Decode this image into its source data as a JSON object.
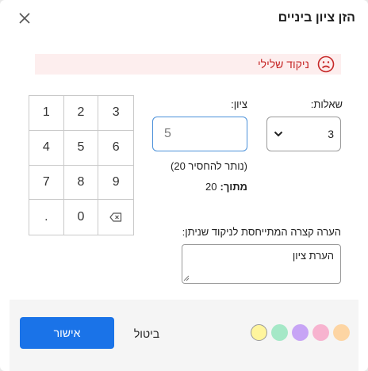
{
  "dialog": {
    "title": "הזן ציון ביניים",
    "alert_text": "ניקוד שלילי"
  },
  "keypad": {
    "keys": [
      "1",
      "2",
      "3",
      "4",
      "5",
      "6",
      "7",
      "8",
      "9",
      ".",
      "0",
      "backspace"
    ]
  },
  "form": {
    "questions_label": "שאלות:",
    "questions_value": "3",
    "grade_label": "ציון:",
    "grade_value": "5",
    "remaining_text": "(נותר להחסיר 20)",
    "out_of_label": "מתוך:",
    "out_of_value": "20",
    "note_label": "הערה קצרה המתייחסת לניקוד שניתן:",
    "note_value": "הערת ציון"
  },
  "footer": {
    "ok_label": "אישור",
    "cancel_label": "ביטול",
    "swatches": [
      "#fff59d",
      "#a5e8c7",
      "#c7a4f5",
      "#f7b3cf",
      "#fdd5a3"
    ]
  },
  "colors": {
    "accent": "#1a73e8",
    "alert_text": "#c62828",
    "alert_bg": "#fdeeee"
  }
}
